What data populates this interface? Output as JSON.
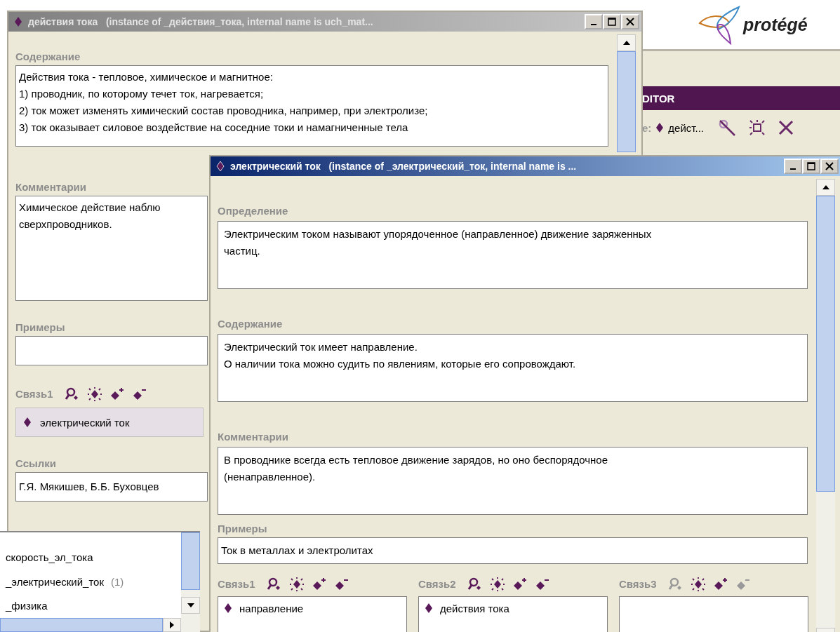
{
  "back_window": {
    "title": "действия тока   (instance of _действия_тока, internal name is uch_mat...",
    "active": false,
    "fields": [
      {
        "kind": "text",
        "label": "Содержание",
        "lines": [
          "Действия тока - тепловое, химическое и магнитное:",
          "1) проводник, по которому течет ток, нагревается;",
          "2) ток может изменять химический состав проводника, например, при электролизе;",
          "3) ток оказывает силовое воздействие на соседние токи и намагниченные тела"
        ]
      },
      {
        "kind": "text",
        "label": "Комментарии",
        "lines": [
          "Химическое действие наблю",
          "сверхпроводников."
        ]
      },
      {
        "kind": "field",
        "label": "Примеры"
      },
      {
        "kind": "slot",
        "label": "Связь1",
        "icons": [
          {
            "kind": "find",
            "disabled": false
          },
          {
            "kind": "view",
            "disabled": false
          },
          {
            "kind": "add",
            "disabled": false
          },
          {
            "kind": "remove",
            "disabled": false
          }
        ],
        "items": [
          {
            "name": "электрический ток",
            "selected": true
          }
        ]
      },
      {
        "kind": "field",
        "label": "Ссылки",
        "value": "Г.Я. Мякишев, Б.Б. Буховцев"
      }
    ]
  },
  "editor_panel": {
    "logo": "protégé",
    "header": "DITOR",
    "row_label": "e:",
    "instance": "дейст..."
  },
  "class_list": {
    "items": [
      {
        "name": "скорость_эл_тока"
      },
      {
        "name": "_электрический_ток",
        "count": "(1)"
      },
      {
        "name": "_физика"
      }
    ]
  },
  "front_window": {
    "title": "электрический ток   (instance of _электрический_ток, internal name is ...",
    "active": true,
    "fields": [
      {
        "kind": "text",
        "label": "Определение",
        "lines": [
          "Электрическим током называют упорядоченное (направленное) движение заряженных",
          "частиц."
        ]
      },
      {
        "kind": "text",
        "label": "Содержание",
        "lines": [
          "Электрический ток имеет направление.",
          "О наличии тока можно судить по явлениям, которые его сопровождают."
        ]
      },
      {
        "kind": "text",
        "label": "Комментарии",
        "lines": [
          "В проводнике всегда есть тепловое движение зарядов, но оно беспорядочное",
          "(ненаправленное)."
        ]
      },
      {
        "kind": "field",
        "label": "Примеры",
        "value": "Ток в металлах и электролитах"
      }
    ],
    "slots": [
      {
        "label": "Связь1",
        "icons": [
          {
            "kind": "find",
            "disabled": false
          },
          {
            "kind": "view",
            "disabled": false
          },
          {
            "kind": "add",
            "disabled": false
          },
          {
            "kind": "remove",
            "disabled": false
          }
        ],
        "items": [
          {
            "name": "направление",
            "selected": false
          }
        ]
      },
      {
        "label": "Связь2",
        "icons": [
          {
            "kind": "find",
            "disabled": false
          },
          {
            "kind": "view",
            "disabled": false
          },
          {
            "kind": "add",
            "disabled": false
          },
          {
            "kind": "remove",
            "disabled": false
          }
        ],
        "items": [
          {
            "name": "действия тока",
            "selected": false
          }
        ]
      },
      {
        "label": "Связь3",
        "icons": [
          {
            "kind": "find",
            "disabled": true
          },
          {
            "kind": "view",
            "disabled": false
          },
          {
            "kind": "add",
            "disabled": false
          },
          {
            "kind": "remove",
            "disabled": true
          }
        ]
      }
    ]
  }
}
